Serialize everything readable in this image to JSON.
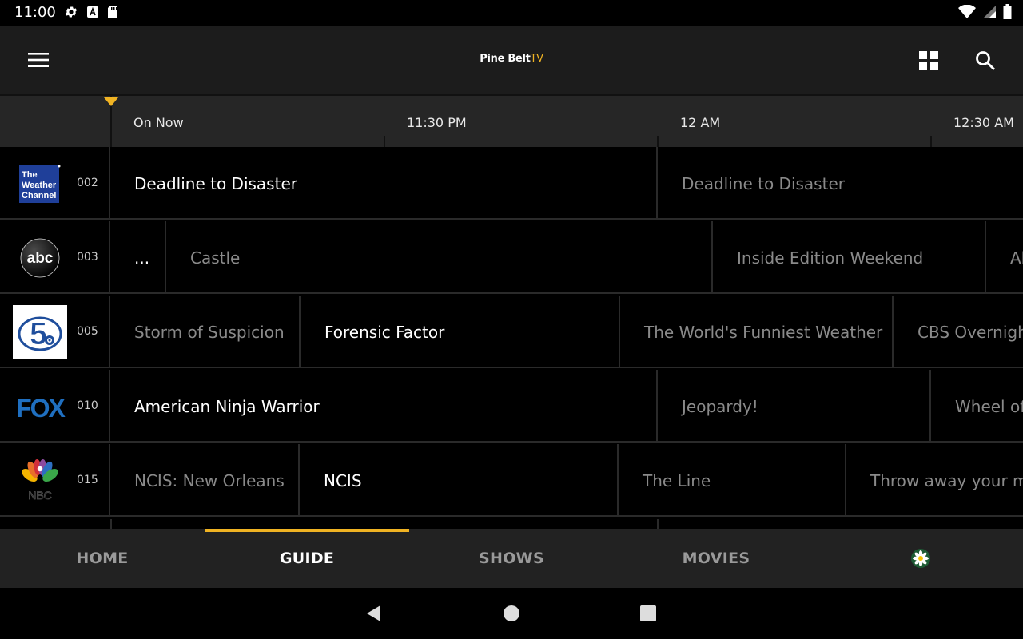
{
  "status_bar": {
    "time": "11:00"
  },
  "app": {
    "logo_main": "Pine Belt",
    "logo_tv": "TV",
    "accent": "#f0b323"
  },
  "time_header": {
    "labels": [
      "On Now",
      "11:30 PM",
      "12 AM",
      "12:30 AM"
    ]
  },
  "channels": [
    {
      "number": "002",
      "logo": "weather-channel-logo",
      "logo_text": "The Weather Channel",
      "programs": [
        {
          "title": "Deadline to Disaster",
          "current": true
        },
        {
          "title": "Deadline to Disaster",
          "current": false
        }
      ]
    },
    {
      "number": "003",
      "logo": "abc-logo",
      "logo_text": "abc",
      "programs": [
        {
          "title": "...",
          "current": true
        },
        {
          "title": "Castle",
          "current": false
        },
        {
          "title": "Inside Edition Weekend",
          "current": false
        },
        {
          "title": "Al",
          "current": false
        }
      ]
    },
    {
      "number": "005",
      "logo": "wdam-5-logo",
      "logo_text": "5",
      "programs": [
        {
          "title": "Storm of Suspicion",
          "current": false
        },
        {
          "title": "Forensic Factor",
          "current": true
        },
        {
          "title": "The World's Funniest Weather",
          "current": false
        },
        {
          "title": "CBS Overnight",
          "current": false
        }
      ]
    },
    {
      "number": "010",
      "logo": "fox-logo",
      "logo_text": "FOX",
      "programs": [
        {
          "title": "American Ninja Warrior",
          "current": true
        },
        {
          "title": "Jeopardy!",
          "current": false
        },
        {
          "title": "Wheel of",
          "current": false
        }
      ]
    },
    {
      "number": "015",
      "logo": "nbc-logo",
      "logo_text": "NBC",
      "programs": [
        {
          "title": "NCIS: New Orleans",
          "current": false
        },
        {
          "title": "NCIS",
          "current": true
        },
        {
          "title": "The Line",
          "current": false
        },
        {
          "title": "Throw away your ma",
          "current": false
        }
      ]
    }
  ],
  "bottom_nav": {
    "tabs": [
      "HOME",
      "GUIDE",
      "SHOWS",
      "MOVIES"
    ],
    "active": "GUIDE"
  }
}
